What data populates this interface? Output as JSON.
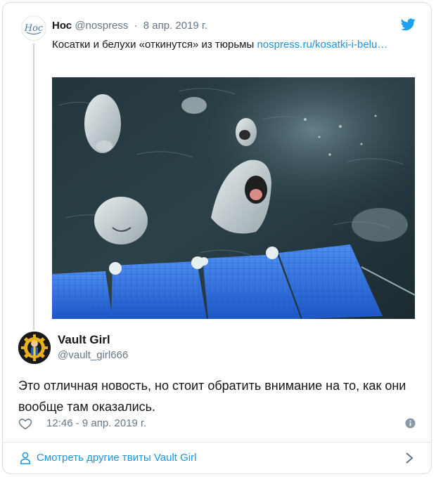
{
  "quoted_tweet": {
    "author_name": "Нос",
    "author_handle": "@nospress",
    "date": "8 апр. 2019 г.",
    "text": "Косатки и белухи «откинутся» из тюрьмы ",
    "link_text": "nospress.ru/kosatki-i-belu…",
    "avatar_icon": "nos-logo-icon",
    "platform_icon": "twitter-bird-icon",
    "accent_color": "#1da1f2"
  },
  "reply_tweet": {
    "author_name": "Vault Girl",
    "author_handle": "@vault_girl666",
    "text": "Это отличная новость, но стоит обратить внимание на то, как они вообще там оказались.",
    "timestamp": "12:46 - 9 апр. 2019 г.",
    "like_icon": "heart-icon",
    "info_icon": "info-icon"
  },
  "footer": {
    "more_tweets_label": "Смотреть другие твиты Vault Girl",
    "person_icon": "person-icon",
    "chevron_icon": "chevron-right-icon",
    "link_color": "#1b95e0"
  }
}
